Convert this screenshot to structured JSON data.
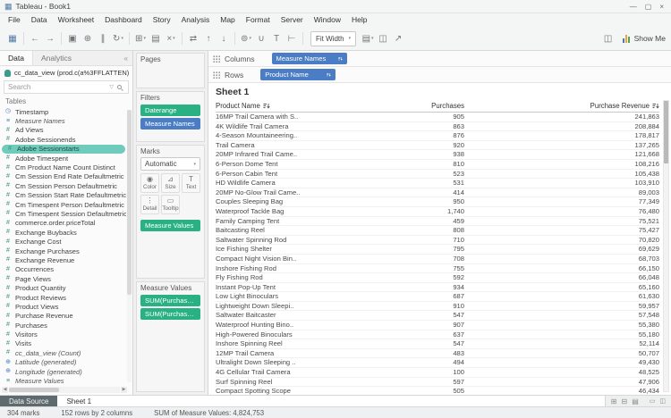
{
  "window": {
    "title": "Tableau - Book1"
  },
  "colors": {
    "pill_blue": "#4a7dc4",
    "pill_green": "#29b184",
    "field_selected_bg": "#6fccbc",
    "measure_green": "#38937f",
    "datasource_teal": "#3a9a8c"
  },
  "title_bar": {
    "controls": [
      {
        "name": "minimize-icon",
        "glyph": "—"
      },
      {
        "name": "maximize-icon",
        "glyph": "▢"
      },
      {
        "name": "close-icon",
        "glyph": "×"
      }
    ]
  },
  "menu": [
    "File",
    "Data",
    "Worksheet",
    "Dashboard",
    "Story",
    "Analysis",
    "Map",
    "Format",
    "Server",
    "Window",
    "Help"
  ],
  "toolbar": {
    "fit_value": "Fit Width",
    "show_me": "Show Me",
    "items": [
      {
        "name": "tableau-logo-icon",
        "glyph": "▦"
      },
      {
        "sep": true
      },
      {
        "name": "undo-icon",
        "glyph": "←"
      },
      {
        "name": "redo-icon",
        "glyph": "→"
      },
      {
        "sep": true
      },
      {
        "name": "save-icon",
        "glyph": "▣"
      },
      {
        "name": "add-data-source-icon",
        "glyph": "⊕"
      },
      {
        "name": "pause-updates-icon",
        "glyph": "∥"
      },
      {
        "name": "run-update-icon",
        "glyph": "↻",
        "caret": true
      },
      {
        "sep": true
      },
      {
        "name": "new-worksheet-icon",
        "glyph": "⊞",
        "caret": true
      },
      {
        "name": "duplicate-sheet-icon",
        "glyph": "▤"
      },
      {
        "name": "clear-sheet-icon",
        "glyph": "×",
        "caret": true
      },
      {
        "sep": true
      },
      {
        "name": "swap-rows-columns-icon",
        "glyph": "⇄"
      },
      {
        "name": "sort-ascending-icon",
        "glyph": "↑"
      },
      {
        "name": "sort-descending-icon",
        "glyph": "↓"
      },
      {
        "sep": true
      },
      {
        "name": "highlight-icon",
        "glyph": "⊚",
        "caret": true
      },
      {
        "name": "group-members-icon",
        "glyph": "∪"
      },
      {
        "name": "show-mark-labels-icon",
        "glyph": "T"
      },
      {
        "name": "fix-axes-icon",
        "glyph": "⊢"
      },
      {
        "sep": true
      },
      {
        "fit": true
      },
      {
        "name": "show-hide-cards-icon",
        "glyph": "▤",
        "caret": true
      },
      {
        "name": "presentation-mode-icon",
        "glyph": "◫"
      },
      {
        "name": "share-workbook-icon",
        "glyph": "↗"
      }
    ],
    "right_icons": [
      {
        "name": "pane-controls-icon",
        "glyph": "◫"
      }
    ]
  },
  "sidebar": {
    "tabs": [
      "Data",
      "Analytics"
    ],
    "collapse_glyph": "«",
    "data_source": "cc_data_view (prod.c(a%3FFLATTEN)",
    "search_placeholder": "Search",
    "section_title": "Tables",
    "icon_glyphs": {
      "number": "#",
      "datetime": "◷",
      "globe": "⊕",
      "names": "≡",
      "values": "≡"
    },
    "fields": [
      {
        "label": "Timestamp",
        "icon": "datetime"
      },
      {
        "label": "Measure Names",
        "icon": "names",
        "italic": true
      },
      {
        "label": "Ad Views",
        "icon": "number"
      },
      {
        "label": "Adobe Sessionends",
        "icon": "number"
      },
      {
        "label": "Adobe Sessionstarts",
        "icon": "number",
        "selected": true
      },
      {
        "label": "Adobe Timespent",
        "icon": "number"
      },
      {
        "label": "Cm Product Name Count Distinct",
        "icon": "number"
      },
      {
        "label": "Cm Session End Rate Defaultmetric",
        "icon": "number"
      },
      {
        "label": "Cm Session Person Defaultmetric",
        "icon": "number"
      },
      {
        "label": "Cm Session Start Rate Defaultmetric",
        "icon": "number"
      },
      {
        "label": "Cm Timespent Person Defaultmetric",
        "icon": "number"
      },
      {
        "label": "Cm Timespent Session Defaultmetric",
        "icon": "number"
      },
      {
        "label": "commerce.order.priceTotal",
        "icon": "number"
      },
      {
        "label": "Exchange Buybacks",
        "icon": "number"
      },
      {
        "label": "Exchange Cost",
        "icon": "number"
      },
      {
        "label": "Exchange Purchases",
        "icon": "number"
      },
      {
        "label": "Exchange Revenue",
        "icon": "number"
      },
      {
        "label": "Occurrences",
        "icon": "number"
      },
      {
        "label": "Page Views",
        "icon": "number"
      },
      {
        "label": "Product Quantity",
        "icon": "number"
      },
      {
        "label": "Product Reviews",
        "icon": "number"
      },
      {
        "label": "Product Views",
        "icon": "number"
      },
      {
        "label": "Purchase Revenue",
        "icon": "number"
      },
      {
        "label": "Purchases",
        "icon": "number"
      },
      {
        "label": "Visitors",
        "icon": "number"
      },
      {
        "label": "Visits",
        "icon": "number"
      },
      {
        "label": "cc_data_view (Count)",
        "icon": "number",
        "italic": true
      },
      {
        "label": "Latitude (generated)",
        "icon": "globe",
        "italic": true
      },
      {
        "label": "Longitude (generated)",
        "icon": "globe",
        "italic": true
      },
      {
        "label": "Measure Values",
        "icon": "values",
        "italic": true
      }
    ]
  },
  "pages_card": {
    "title": "Pages"
  },
  "filters_card": {
    "title": "Filters",
    "pills": [
      {
        "label": "Daterange",
        "color": "green"
      },
      {
        "label": "Measure Names",
        "color": "blue"
      }
    ]
  },
  "marks_card": {
    "title": "Marks",
    "mark_type": "Automatic",
    "buttons": [
      {
        "label": "Color",
        "glyph": "◉"
      },
      {
        "label": "Size",
        "glyph": "⊿"
      },
      {
        "label": "Text",
        "glyph": "T"
      },
      {
        "label": "Detail",
        "glyph": "⋮"
      },
      {
        "label": "Tooltip",
        "glyph": "▭"
      }
    ],
    "pills": [
      {
        "label": "Measure Values",
        "color": "green"
      }
    ]
  },
  "measure_values_card": {
    "title": "Measure Values",
    "pills": [
      {
        "label": "SUM(Purchases)",
        "color": "green"
      },
      {
        "label": "SUM(Purchase Reve..",
        "color": "green"
      }
    ]
  },
  "shelves": {
    "columns_label": "Columns",
    "rows_label": "Rows",
    "columns_pills": [
      {
        "label": "Measure Names",
        "color": "blue",
        "sort": true
      }
    ],
    "rows_pills": [
      {
        "label": "Product Name",
        "color": "blue",
        "sort": true
      }
    ]
  },
  "sheet": {
    "title": "Sheet 1"
  },
  "table": {
    "row_header": "Product Name",
    "measures": [
      "Purchases",
      "Purchase Revenue"
    ],
    "rows": [
      [
        "16MP Trail Camera with S..",
        "905",
        "241,863"
      ],
      [
        "4K Wildlife Trail Camera",
        "863",
        "208,884"
      ],
      [
        "4-Season Mountaineering..",
        "876",
        "178,817"
      ],
      [
        "Trail Camera",
        "920",
        "137,265"
      ],
      [
        "20MP Infrared Trail Came..",
        "938",
        "121,668"
      ],
      [
        "6-Person Dome Tent",
        "810",
        "108,216"
      ],
      [
        "6-Person Cabin Tent",
        "523",
        "105,438"
      ],
      [
        "HD Wildlife Camera",
        "531",
        "103,910"
      ],
      [
        "20MP No-Glow Trail Came..",
        "414",
        "89,003"
      ],
      [
        "Couples Sleeping Bag",
        "950",
        "77,349"
      ],
      [
        "Waterproof Tackle Bag",
        "1,740",
        "76,480"
      ],
      [
        "Family Camping Tent",
        "459",
        "75,521"
      ],
      [
        "Baitcasting Reel",
        "808",
        "75,427"
      ],
      [
        "Saltwater Spinning Rod",
        "710",
        "70,820"
      ],
      [
        "Ice Fishing Shelter",
        "795",
        "69,629"
      ],
      [
        "Compact Night Vision Bin..",
        "708",
        "68,703"
      ],
      [
        "Inshore Fishing Rod",
        "755",
        "66,150"
      ],
      [
        "Fly Fishing Rod",
        "592",
        "66,048"
      ],
      [
        "Instant Pop-Up Tent",
        "934",
        "65,160"
      ],
      [
        "Low Light Binoculars",
        "687",
        "61,630"
      ],
      [
        "Lightweight Down Sleepi..",
        "910",
        "59,957"
      ],
      [
        "Saltwater Baitcaster",
        "547",
        "57,548"
      ],
      [
        "Waterproof Hunting Bino..",
        "907",
        "55,380"
      ],
      [
        "High-Powered Binoculars",
        "637",
        "55,180"
      ],
      [
        "Inshore Spinning Reel",
        "547",
        "52,114"
      ],
      [
        "12MP Trail Camera",
        "483",
        "50,707"
      ],
      [
        "Ultralight Down Sleeping ..",
        "494",
        "49,430"
      ],
      [
        "4G Cellular Trail Camera",
        "100",
        "48,525"
      ],
      [
        "Surf Spinning Reel",
        "597",
        "47,906"
      ],
      [
        "Compact Spotting Scope",
        "505",
        "46,434"
      ]
    ]
  },
  "bottom_tabs": {
    "data_source": "Data Source",
    "sheet": "Sheet 1",
    "new_icons": [
      {
        "name": "new-worksheet-tab-icon",
        "glyph": "⊞"
      },
      {
        "name": "new-dashboard-tab-icon",
        "glyph": "⊟"
      },
      {
        "name": "new-story-tab-icon",
        "glyph": "▤"
      }
    ],
    "right_icons": [
      {
        "name": "show-filmstrip-icon",
        "glyph": "▭"
      },
      {
        "name": "show-sheet-sorter-icon",
        "glyph": "◫"
      }
    ]
  },
  "status_bar": {
    "marks": "304 marks",
    "rows_cols": "152 rows by 2 columns",
    "sum": "SUM of Measure Values: 4,824,753"
  }
}
